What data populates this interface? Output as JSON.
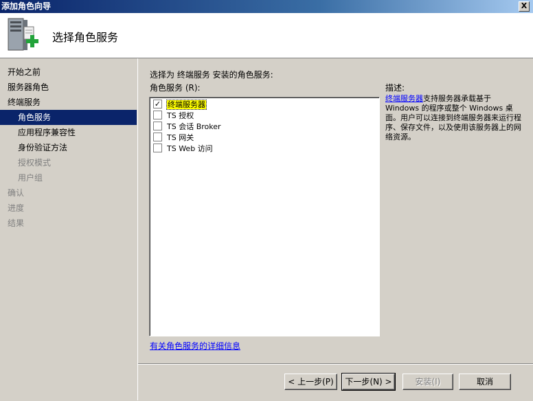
{
  "window": {
    "title": "添加角色向导",
    "close_label": "X"
  },
  "header": {
    "title": "选择角色服务",
    "icon": "server-add-icon"
  },
  "sidebar": {
    "items": [
      {
        "label": "开始之前",
        "level": 1,
        "state": "normal"
      },
      {
        "label": "服务器角色",
        "level": 1,
        "state": "normal"
      },
      {
        "label": "终端服务",
        "level": 1,
        "state": "normal"
      },
      {
        "label": "角色服务",
        "level": 2,
        "state": "selected"
      },
      {
        "label": "应用程序兼容性",
        "level": 2,
        "state": "normal"
      },
      {
        "label": "身份验证方法",
        "level": 2,
        "state": "normal"
      },
      {
        "label": "授权模式",
        "level": 2,
        "state": "disabled"
      },
      {
        "label": "用户组",
        "level": 2,
        "state": "disabled"
      },
      {
        "label": "确认",
        "level": 1,
        "state": "disabled"
      },
      {
        "label": "进度",
        "level": 1,
        "state": "disabled"
      },
      {
        "label": "结果",
        "level": 1,
        "state": "disabled"
      }
    ]
  },
  "main": {
    "prompt": "选择为 终端服务 安装的角色服务:",
    "list_label": "角色服务 (R):",
    "role_services": [
      {
        "label": "终端服务器",
        "checked": true,
        "focused": true
      },
      {
        "label": "TS 授权",
        "checked": false
      },
      {
        "label": "TS 会话 Broker",
        "checked": false
      },
      {
        "label": "TS 网关",
        "checked": false
      },
      {
        "label": "TS Web 访问",
        "checked": false
      }
    ],
    "description_label": "描述:",
    "description_link": "终端服务器",
    "description_text": "支持服务器承载基于 Windows 的程序或整个 Windows 桌面。用户可以连接到终端服务器来运行程序、保存文件，以及使用该服务器上的网络资源。",
    "more_info_link": "有关角色服务的详细信息"
  },
  "footer": {
    "back_label": "< 上一步(P)",
    "next_label": "下一步(N) >",
    "install_label": "安装(I)",
    "cancel_label": "取消"
  },
  "colors": {
    "selection": "#0a246a",
    "focus_highlight": "#ffff00",
    "link": "#0000ff",
    "face": "#d4d0c8"
  }
}
